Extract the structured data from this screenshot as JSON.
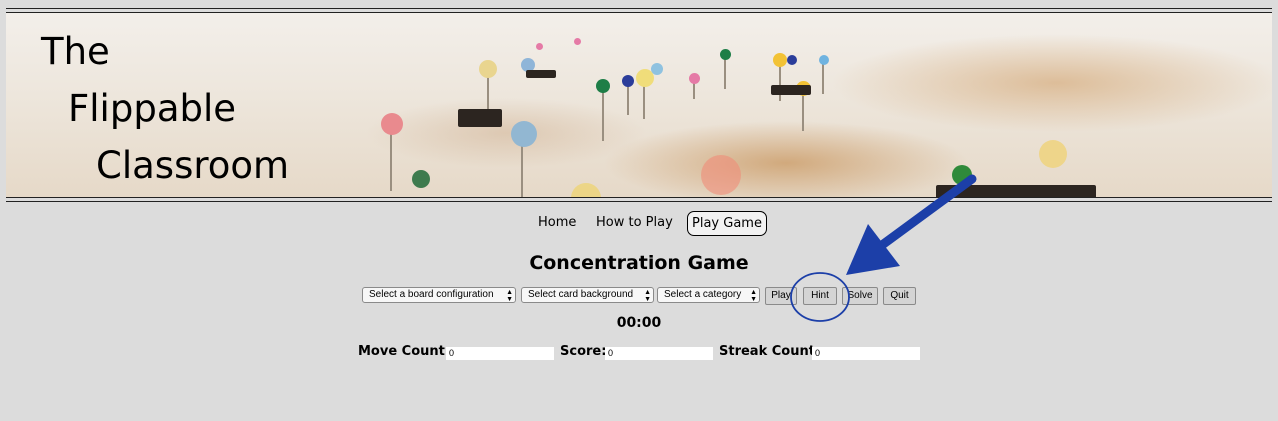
{
  "banner": {
    "title_lines": [
      "The",
      "Flippable",
      "Classroom"
    ]
  },
  "nav": {
    "items": [
      {
        "label": "Home"
      },
      {
        "label": "How to Play"
      },
      {
        "label": "Play Game"
      }
    ],
    "active": "Play Game"
  },
  "game": {
    "title": "Concentration Game",
    "selects": {
      "board": "Select a board configuration",
      "background": "Select card background",
      "category": "Select a category"
    },
    "buttons": {
      "play": "Play",
      "hint": "Hint",
      "solve": "Solve",
      "quit": "Quit"
    },
    "timer": "00:00",
    "stats": {
      "move_count_label": "Move Count:",
      "move_count_value": "0",
      "score_label": "Score:",
      "score_value": "0",
      "streak_label": "Streak Count:",
      "streak_value": "0"
    }
  },
  "annotation": {
    "color": "#1c3fa8",
    "icon": "arrow-pointing-to-hint-circle"
  }
}
